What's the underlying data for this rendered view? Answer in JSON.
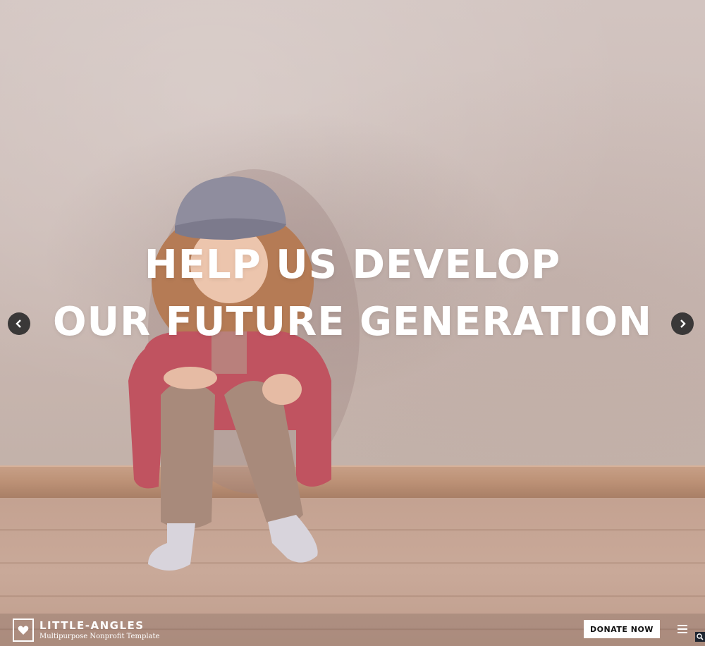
{
  "hero": {
    "headline_line1": "HELP US DEVELOP",
    "headline_line2": "OUR FUTURE GENERATION"
  },
  "slider": {
    "prev_icon": "chevron-left-icon",
    "next_icon": "chevron-right-icon"
  },
  "brand": {
    "name": "LITTLE-ANGLES",
    "tagline": "Multipurpose Nonprofit Template",
    "logo_icon": "heart-icon"
  },
  "nav": {
    "donate_label": "DONATE NOW",
    "menu_icon": "hamburger-menu-icon"
  },
  "colors": {
    "text": "#ffffff",
    "arrow_bg": "#3a3838",
    "button_bg": "#ffffff"
  }
}
